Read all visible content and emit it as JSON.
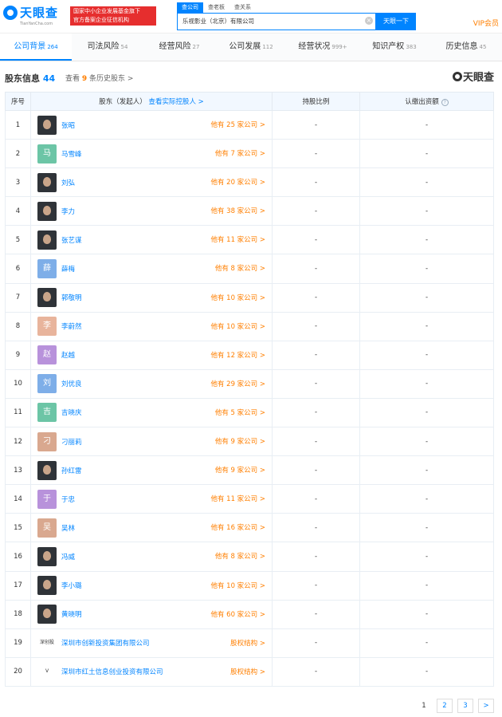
{
  "brand": {
    "name": "天眼查",
    "sub": "TianYanCha.com",
    "badge1": "国家中小企业发展基金旗下",
    "badge2": "官方备案企业征信机构"
  },
  "search": {
    "tabs": [
      "查公司",
      "查老板",
      "查关系"
    ],
    "value": "乐视影业（北京）有限公司",
    "button": "天眼一下",
    "clear": "×"
  },
  "vip": "VIP会员",
  "tabs": [
    {
      "label": "公司背景",
      "count": "264"
    },
    {
      "label": "司法风险",
      "count": "54"
    },
    {
      "label": "经营风险",
      "count": "27"
    },
    {
      "label": "公司发展",
      "count": "112"
    },
    {
      "label": "经营状况",
      "count": "999+"
    },
    {
      "label": "知识产权",
      "count": "383"
    },
    {
      "label": "历史信息",
      "count": "45"
    }
  ],
  "section": {
    "title": "股东信息",
    "count": "44",
    "hist_pre": "查看",
    "hist_num": "9",
    "hist_post": "条历史股东 >",
    "brand": "天眼查"
  },
  "columns": {
    "idx": "序号",
    "holder": "股东（发起人）",
    "holder_link": "查看实际控股人 >",
    "ratio": "持股比例",
    "capital": "认缴出资额",
    "help": "?"
  },
  "rows": [
    {
      "idx": "1",
      "name": "张昭",
      "av": "photo",
      "more": "他有 25 家公司 >",
      "ratio": "-",
      "capital": "-"
    },
    {
      "idx": "2",
      "name": "马雪峰",
      "av": "马",
      "color": "#6cc5a6",
      "more": "他有 7 家公司 >",
      "ratio": "-",
      "capital": "-"
    },
    {
      "idx": "3",
      "name": "刘弘",
      "av": "photo",
      "more": "他有 20 家公司 >",
      "ratio": "-",
      "capital": "-"
    },
    {
      "idx": "4",
      "name": "李力",
      "av": "photo",
      "more": "他有 38 家公司 >",
      "ratio": "-",
      "capital": "-"
    },
    {
      "idx": "5",
      "name": "张艺谋",
      "av": "photo",
      "more": "他有 11 家公司 >",
      "ratio": "-",
      "capital": "-"
    },
    {
      "idx": "6",
      "name": "薛梅",
      "av": "薛",
      "color": "#7eaee8",
      "more": "他有 8 家公司 >",
      "ratio": "-",
      "capital": "-"
    },
    {
      "idx": "7",
      "name": "郭敬明",
      "av": "photo",
      "more": "他有 10 家公司 >",
      "ratio": "-",
      "capital": "-"
    },
    {
      "idx": "8",
      "name": "李蔚然",
      "av": "李",
      "color": "#e8b49c",
      "more": "他有 10 家公司 >",
      "ratio": "-",
      "capital": "-"
    },
    {
      "idx": "9",
      "name": "赵越",
      "av": "赵",
      "color": "#b892db",
      "more": "他有 12 家公司 >",
      "ratio": "-",
      "capital": "-"
    },
    {
      "idx": "10",
      "name": "刘优良",
      "av": "刘",
      "color": "#7eaee8",
      "more": "他有 29 家公司 >",
      "ratio": "-",
      "capital": "-"
    },
    {
      "idx": "11",
      "name": "吉晓庆",
      "av": "吉",
      "color": "#6cc5a6",
      "more": "他有 5 家公司 >",
      "ratio": "-",
      "capital": "-"
    },
    {
      "idx": "12",
      "name": "刁丽莉",
      "av": "刁",
      "color": "#d9a88f",
      "more": "他有 9 家公司 >",
      "ratio": "-",
      "capital": "-"
    },
    {
      "idx": "13",
      "name": "孙红雷",
      "av": "photo",
      "more": "他有 9 家公司 >",
      "ratio": "-",
      "capital": "-"
    },
    {
      "idx": "14",
      "name": "于忠",
      "av": "于",
      "color": "#b892db",
      "more": "他有 11 家公司 >",
      "ratio": "-",
      "capital": "-"
    },
    {
      "idx": "15",
      "name": "吴林",
      "av": "吴",
      "color": "#d9a88f",
      "more": "他有 16 家公司 >",
      "ratio": "-",
      "capital": "-"
    },
    {
      "idx": "16",
      "name": "冯威",
      "av": "photo",
      "more": "他有 8 家公司 >",
      "ratio": "-",
      "capital": "-"
    },
    {
      "idx": "17",
      "name": "李小璐",
      "av": "photo",
      "more": "他有 10 家公司 >",
      "ratio": "-",
      "capital": "-"
    },
    {
      "idx": "18",
      "name": "黄晓明",
      "av": "photo",
      "more": "他有 60 家公司 >",
      "ratio": "-",
      "capital": "-"
    },
    {
      "idx": "19",
      "name": "深圳市创新投资集团有限公司",
      "av": "logo",
      "logo_text": "深创投",
      "more": "股权结构 >",
      "ratio": "-",
      "capital": "-"
    },
    {
      "idx": "20",
      "name": "深圳市红土信息创业投资有限公司",
      "av": "logo",
      "logo_text": "V",
      "more": "股权结构 >",
      "ratio": "-",
      "capital": "-"
    }
  ],
  "pager": [
    "1",
    "2",
    "3",
    ">"
  ]
}
